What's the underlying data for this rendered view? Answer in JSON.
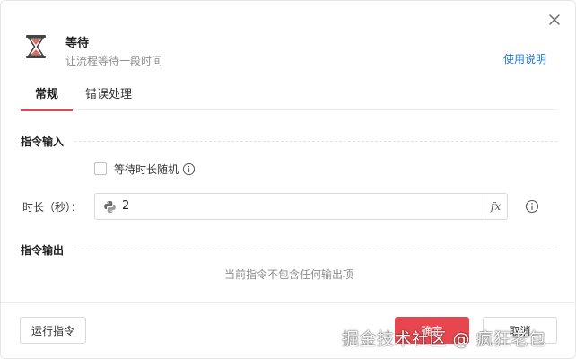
{
  "header": {
    "title": "等待",
    "subtitle": "让流程等待一段时间",
    "help_link": "使用说明",
    "icon": "hourglass-icon"
  },
  "tabs": [
    {
      "label": "常规",
      "active": true
    },
    {
      "label": "错误处理",
      "active": false
    }
  ],
  "sections": {
    "input_title": "指令输入",
    "output_title": "指令输出"
  },
  "input": {
    "random_checkbox_label": "等待时长随机",
    "random_checked": false,
    "duration_label": "时长（秒）：",
    "duration_value": "2",
    "fx_label": "fx"
  },
  "output": {
    "empty_text": "当前指令不包含任何输出项"
  },
  "footer": {
    "run_label": "运行指令",
    "confirm_label": "确定",
    "cancel_label": "取消"
  },
  "watermark": "掘金技术社区 @ 疯狂老包",
  "colors": {
    "accent": "#e8464f",
    "link": "#1f78d1",
    "muted": "#8c8c8c"
  }
}
